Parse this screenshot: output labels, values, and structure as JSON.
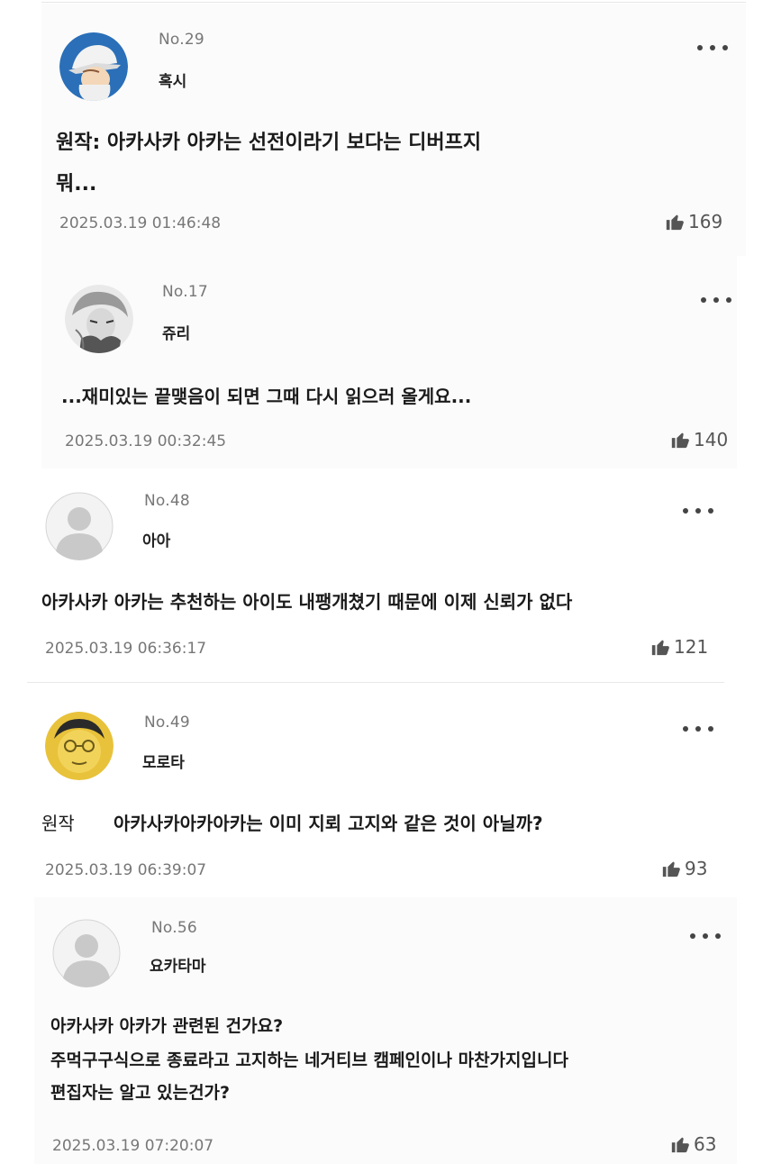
{
  "comments": [
    {
      "no": "No.29",
      "nick": "혹시",
      "lines": [
        "원작: 아카사카 아카는 선전이라기 보다는 디버프지",
        "뭐..."
      ],
      "date": "2025.03.19 01:46:48",
      "likes": "169",
      "avatar": "baseball-cap-avatar"
    },
    {
      "no": "No.17",
      "nick": "쥬리",
      "lines": [
        "...재미있는 끝맺음이 되면 그때 다시 읽으러 올게요..."
      ],
      "date": "2025.03.19 00:32:45",
      "likes": "140",
      "avatar": "sketch-portrait-avatar"
    },
    {
      "no": "No.48",
      "nick": "아아",
      "lines": [
        "아카사카 아카는 추천하는 아이도 내팽개쳤기 때문에 이제 신뢰가 없다"
      ],
      "date": "2025.03.19 06:36:17",
      "likes": "121",
      "avatar": "default-avatar"
    },
    {
      "no": "No.49",
      "nick": "모로타",
      "lines": [
        "원작",
        "아카사카아카아카는 이미 지뢰 고지와 같은 것이 아닐까?"
      ],
      "date": "2025.03.19 06:39:07",
      "likes": "93",
      "avatar": "gold-face-avatar"
    },
    {
      "no": "No.56",
      "nick": "요카타마",
      "lines": [
        "아카사카 아카가 관련된 건가요?",
        "주먹구구식으로 종료라고 고지하는 네거티브 캠페인이나 마찬가지입니다",
        "편집자는 알고 있는건가?"
      ],
      "date": "2025.03.19 07:20:07",
      "likes": "63",
      "avatar": "default-avatar"
    }
  ],
  "colors": {
    "avatarBlue": "#2a6fb8",
    "gold": "#e8c23a",
    "defaultGray": "#c9c9c9"
  }
}
